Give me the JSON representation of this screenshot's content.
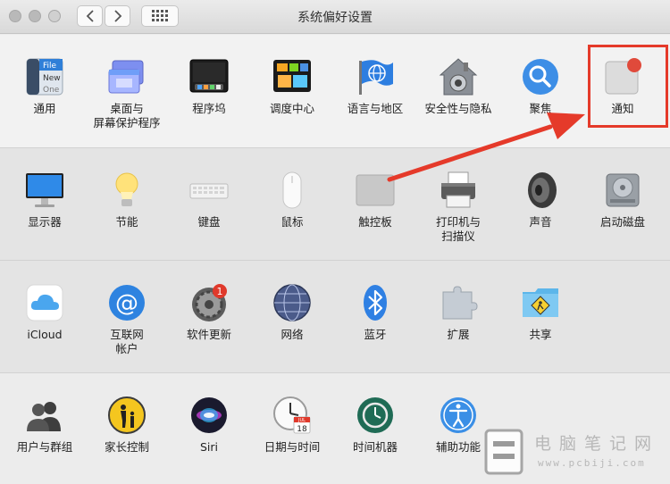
{
  "window": {
    "title": "系统偏好设置"
  },
  "sections": [
    {
      "panes": [
        {
          "id": "general",
          "label": "通用",
          "icon": "general-icon"
        },
        {
          "id": "desktop",
          "label": "桌面与\n屏幕保护程序",
          "icon": "desktop-screensaver-icon"
        },
        {
          "id": "dock",
          "label": "程序坞",
          "icon": "dock-icon"
        },
        {
          "id": "mission",
          "label": "调度中心",
          "icon": "mission-control-icon"
        },
        {
          "id": "language",
          "label": "语言与地区",
          "icon": "language-region-icon"
        },
        {
          "id": "security",
          "label": "安全性与隐私",
          "icon": "security-privacy-icon"
        },
        {
          "id": "spotlight",
          "label": "聚焦",
          "icon": "spotlight-icon"
        },
        {
          "id": "notifications",
          "label": "通知",
          "icon": "notifications-icon"
        }
      ]
    },
    {
      "panes": [
        {
          "id": "displays",
          "label": "显示器",
          "icon": "displays-icon"
        },
        {
          "id": "energy",
          "label": "节能",
          "icon": "energy-saver-icon"
        },
        {
          "id": "keyboard",
          "label": "键盘",
          "icon": "keyboard-icon"
        },
        {
          "id": "mouse",
          "label": "鼠标",
          "icon": "mouse-icon"
        },
        {
          "id": "trackpad",
          "label": "触控板",
          "icon": "trackpad-icon"
        },
        {
          "id": "printers",
          "label": "打印机与\n扫描仪",
          "icon": "printer-icon"
        },
        {
          "id": "sound",
          "label": "声音",
          "icon": "sound-icon"
        },
        {
          "id": "startup",
          "label": "启动磁盘",
          "icon": "startup-disk-icon"
        }
      ]
    },
    {
      "panes": [
        {
          "id": "icloud",
          "label": "iCloud",
          "icon": "icloud-icon"
        },
        {
          "id": "internet",
          "label": "互联网\n帐户",
          "icon": "internet-accounts-icon"
        },
        {
          "id": "swupdate",
          "label": "软件更新",
          "icon": "software-update-icon",
          "badge": "1"
        },
        {
          "id": "network",
          "label": "网络",
          "icon": "network-icon"
        },
        {
          "id": "bluetooth",
          "label": "蓝牙",
          "icon": "bluetooth-icon"
        },
        {
          "id": "extensions",
          "label": "扩展",
          "icon": "extensions-icon"
        },
        {
          "id": "sharing",
          "label": "共享",
          "icon": "sharing-icon"
        }
      ]
    },
    {
      "panes": [
        {
          "id": "users",
          "label": "用户与群组",
          "icon": "users-groups-icon"
        },
        {
          "id": "parental",
          "label": "家长控制",
          "icon": "parental-controls-icon"
        },
        {
          "id": "siri",
          "label": "Siri",
          "icon": "siri-icon"
        },
        {
          "id": "datetime",
          "label": "日期与时间",
          "icon": "date-time-icon",
          "calendar_month": "JUL",
          "calendar_day": "18"
        },
        {
          "id": "timemachine",
          "label": "时间机器",
          "icon": "time-machine-icon"
        },
        {
          "id": "accessibility",
          "label": "辅助功能",
          "icon": "accessibility-icon"
        }
      ]
    }
  ],
  "general_icon_text": [
    "File",
    "New",
    "One"
  ],
  "watermark": {
    "cn": "电脑笔记网",
    "en": "www.pcbiji.com"
  },
  "colors": {
    "highlight": "#e53a2a",
    "accent_blue": "#1e88e5"
  }
}
